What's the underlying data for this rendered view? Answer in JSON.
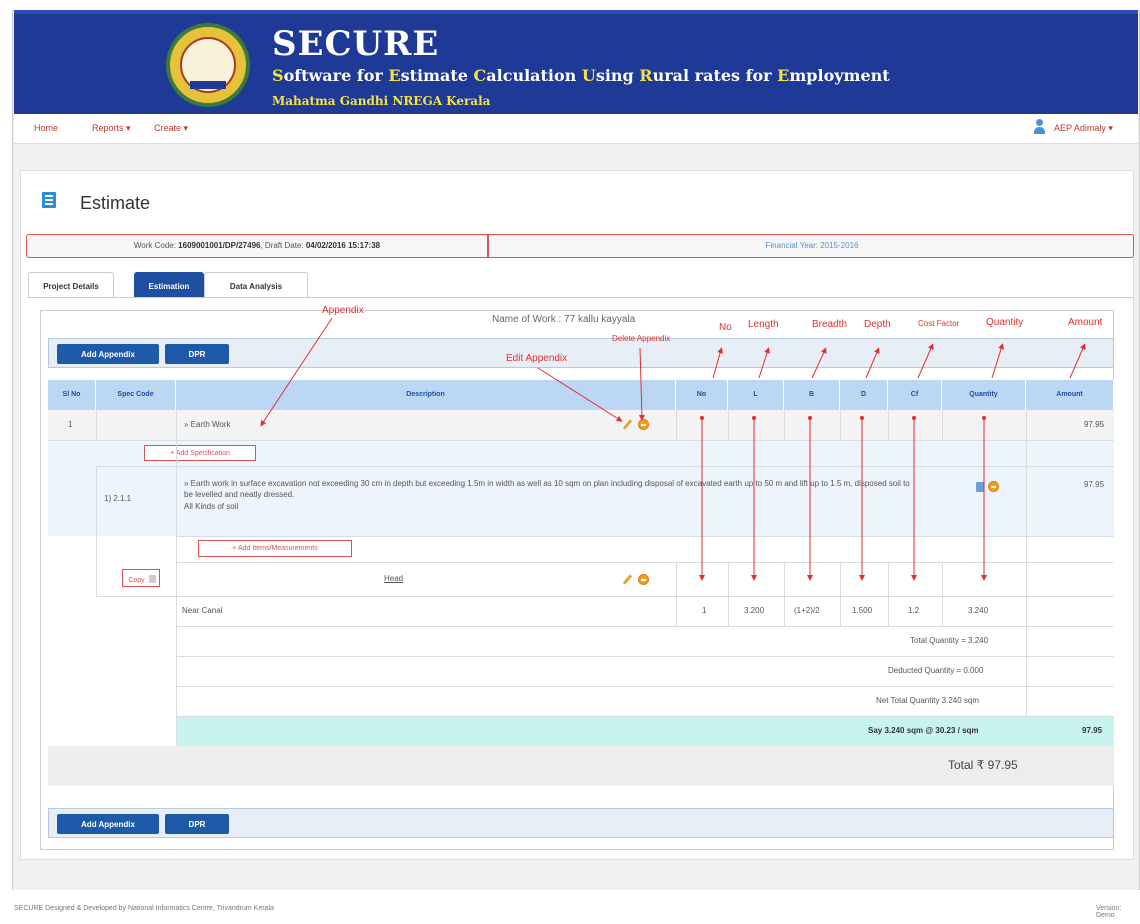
{
  "header": {
    "title": "SECURE",
    "subtitle_parts": [
      {
        "text": "S",
        "accent": true
      },
      {
        "text": "oftware for ",
        "accent": false
      },
      {
        "text": "E",
        "accent": true
      },
      {
        "text": "stimate ",
        "accent": false
      },
      {
        "text": "C",
        "accent": true
      },
      {
        "text": "alculation ",
        "accent": false
      },
      {
        "text": "U",
        "accent": true
      },
      {
        "text": "sing ",
        "accent": false
      },
      {
        "text": "R",
        "accent": true
      },
      {
        "text": "ural rates for ",
        "accent": false
      },
      {
        "text": "E",
        "accent": true
      },
      {
        "text": "mployment",
        "accent": false
      }
    ],
    "tagline": "Mahatma Gandhi NREGA Kerala"
  },
  "nav": {
    "home": "Home",
    "reports": "Reports ▾",
    "create": "Create ▾",
    "user": "AEP Adimaly ▾"
  },
  "page": {
    "title": "Estimate",
    "work_code_label": "Work Code: ",
    "work_code": "1609001001/DP/27496",
    "draft_date_label": ", Draft Date: ",
    "draft_date": "04/02/2016 15:17:38",
    "financial_year_label": "Financial Year: ",
    "financial_year": "2015-2016",
    "name_of_work": "Name of Work : 77 kallu kayyala"
  },
  "tabs": [
    "Project Details",
    "Estimation",
    "Data Analysis"
  ],
  "buttons": {
    "add_appendix": "Add Appendix",
    "dpr": "DPR"
  },
  "table": {
    "headers": [
      "Sl No",
      "Spec Code",
      "Description",
      "No",
      "L",
      "B",
      "D",
      "Cf",
      "Quantity",
      "Amount"
    ],
    "appendix": {
      "sl_no": "1",
      "description": "» Earth Work",
      "amount": "97.95"
    },
    "add_specification": "+ Add Specification",
    "spec": {
      "code": "1) 2.1.1",
      "text": "» Earth work in surface excavation not exceeding 30 cm in depth but exceeding 1.5m in width as well as 10 sqm on plan including disposal of excavated earth up to 50 m and lift up to 1.5 m, disposed soil to be levelled and neatly dressed.",
      "subtext": "All Kinds of soil",
      "amount": "97.95"
    },
    "add_items": "+ Add Items/Measurements",
    "copy": "Copy",
    "head": "Head",
    "measurement": {
      "description": "Near Canal",
      "no": "1",
      "l": "3.200",
      "b": "(1+2)/2",
      "d": "1.500",
      "cf": "1.2",
      "quantity": "3.240"
    },
    "total_quantity": "Total Quantity = 3.240",
    "deducted_quantity": "Deducted Quantity = 0.000",
    "net_total_quantity": "Net Total Quantity 3.240 sqm",
    "say": "Say 3.240 sqm @ 30.23 / sqm",
    "say_amount": "97.95",
    "grand_total": "Total ₹ 97.95"
  },
  "annotations": {
    "appendix": "Appendix",
    "edit_appendix": "Edit Appendix",
    "delete_appendix": "Delete Appendix",
    "no": "No",
    "length": "Length",
    "breadth": "Breadth",
    "depth": "Depth",
    "cost_factor": "Cost Factor",
    "quantity": "Quantity",
    "amount": "Amount"
  },
  "footer": {
    "left": "SECURE Designed & Developed by National Informatics Centre, Trivandrum Kerala",
    "right": "Version: Demo"
  },
  "colors": {
    "banner": "#1f3a96",
    "accent_yellow": "#f2e24a",
    "button_blue": "#1f5aa8",
    "header_cell": "#bcd7f3",
    "annotation_red": "#e03030",
    "say_row": "#c9f3ee"
  }
}
